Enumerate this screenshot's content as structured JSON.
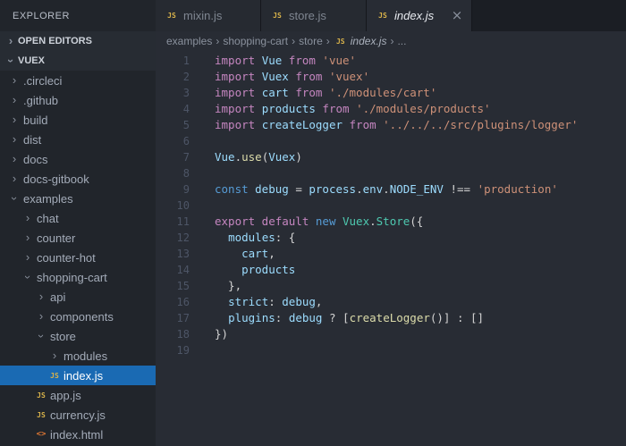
{
  "colors": {
    "editor-bg": "#282c34",
    "sidebar-bg": "#21252b",
    "section-bg": "#272c33",
    "section-fg": "#cdd2da",
    "title-fg": "#b8bec8",
    "tabbar-bg": "#1b1e24",
    "tab-inactive-bg": "#262a31",
    "tab-inactive-fg": "#7f8691",
    "tab-active-fg": "#e8ebf0",
    "tab-border": "#15171c",
    "tree-fg": "#a3abb8",
    "selection-bg": "#1a6ab3",
    "selection-fg": "#ffffff",
    "breadcrumb-fg": "#8a919d",
    "bc-active-fg": "#aab1bc",
    "line-number": "#4d5566",
    "chevron": "#8a919d",
    "js-yellow": "#d8b24a",
    "html-orange": "#e37933",
    "tk-kw": "#c586c0",
    "tk-kw2": "#569cd6",
    "tk-v": "#9cdcfe",
    "tk-s": "#ce9178",
    "tk-fn": "#dcdcaa",
    "tk-cl": "#4ec9b0",
    "tk-p": "#d4d4d4"
  },
  "icons": {
    "js": "JS",
    "html": "<>",
    "chevron": "›"
  },
  "explorer": {
    "title": "EXPLORER",
    "sections": [
      {
        "label": "OPEN EDITORS",
        "expanded": false
      },
      {
        "label": "VUEX",
        "expanded": true
      }
    ],
    "tree": [
      {
        "label": ".circleci",
        "type": "folder",
        "level": 0,
        "expanded": false
      },
      {
        "label": ".github",
        "type": "folder",
        "level": 0,
        "expanded": false
      },
      {
        "label": "build",
        "type": "folder",
        "level": 0,
        "expanded": false
      },
      {
        "label": "dist",
        "type": "folder",
        "level": 0,
        "expanded": false
      },
      {
        "label": "docs",
        "type": "folder",
        "level": 0,
        "expanded": false
      },
      {
        "label": "docs-gitbook",
        "type": "folder",
        "level": 0,
        "expanded": false
      },
      {
        "label": "examples",
        "type": "folder",
        "level": 0,
        "expanded": true
      },
      {
        "label": "chat",
        "type": "folder",
        "level": 1,
        "expanded": false
      },
      {
        "label": "counter",
        "type": "folder",
        "level": 1,
        "expanded": false
      },
      {
        "label": "counter-hot",
        "type": "folder",
        "level": 1,
        "expanded": false
      },
      {
        "label": "shopping-cart",
        "type": "folder",
        "level": 1,
        "expanded": true
      },
      {
        "label": "api",
        "type": "folder",
        "level": 2,
        "expanded": false
      },
      {
        "label": "components",
        "type": "folder",
        "level": 2,
        "expanded": false
      },
      {
        "label": "store",
        "type": "folder",
        "level": 2,
        "expanded": true
      },
      {
        "label": "modules",
        "type": "folder",
        "level": 3,
        "expanded": false
      },
      {
        "label": "index.js",
        "type": "file",
        "icon": "js",
        "level": 3,
        "selected": true
      },
      {
        "label": "app.js",
        "type": "file",
        "icon": "js",
        "level": 2
      },
      {
        "label": "currency.js",
        "type": "file",
        "icon": "js",
        "level": 2
      },
      {
        "label": "index.html",
        "type": "file",
        "icon": "html",
        "level": 2
      }
    ]
  },
  "tabs": [
    {
      "label": "mixin.js",
      "icon": "js",
      "active": false
    },
    {
      "label": "store.js",
      "icon": "js",
      "active": false
    },
    {
      "label": "index.js",
      "icon": "js",
      "active": true,
      "close": "×"
    }
  ],
  "breadcrumb": {
    "separator": "›",
    "items": [
      {
        "label": "examples"
      },
      {
        "label": "shopping-cart"
      },
      {
        "label": "store"
      },
      {
        "label": "index.js",
        "icon": "js",
        "italic": true
      },
      {
        "label": "..."
      }
    ]
  },
  "editor": {
    "lines": [
      {
        "n": "1",
        "t": [
          [
            "kw",
            "import "
          ],
          [
            "v",
            "Vue"
          ],
          [
            "kw",
            " from "
          ],
          [
            "s",
            "'vue'"
          ]
        ]
      },
      {
        "n": "2",
        "t": [
          [
            "kw",
            "import "
          ],
          [
            "v",
            "Vuex"
          ],
          [
            "kw",
            " from "
          ],
          [
            "s",
            "'vuex'"
          ]
        ]
      },
      {
        "n": "3",
        "t": [
          [
            "kw",
            "import "
          ],
          [
            "v",
            "cart"
          ],
          [
            "kw",
            " from "
          ],
          [
            "s",
            "'./modules/cart'"
          ]
        ]
      },
      {
        "n": "4",
        "t": [
          [
            "kw",
            "import "
          ],
          [
            "v",
            "products"
          ],
          [
            "kw",
            " from "
          ],
          [
            "s",
            "'./modules/products'"
          ]
        ]
      },
      {
        "n": "5",
        "t": [
          [
            "kw",
            "import "
          ],
          [
            "v",
            "createLogger"
          ],
          [
            "kw",
            " from "
          ],
          [
            "s",
            "'../../../src/plugins/logger'"
          ]
        ]
      },
      {
        "n": "6",
        "t": []
      },
      {
        "n": "7",
        "t": [
          [
            "v",
            "Vue"
          ],
          [
            "p",
            "."
          ],
          [
            "fn",
            "use"
          ],
          [
            "p",
            "("
          ],
          [
            "v",
            "Vuex"
          ],
          [
            "p",
            ")"
          ]
        ]
      },
      {
        "n": "8",
        "t": []
      },
      {
        "n": "9",
        "t": [
          [
            "kw2",
            "const "
          ],
          [
            "v",
            "debug"
          ],
          [
            "p",
            " = "
          ],
          [
            "v",
            "process"
          ],
          [
            "p",
            "."
          ],
          [
            "v",
            "env"
          ],
          [
            "p",
            "."
          ],
          [
            "v",
            "NODE_ENV"
          ],
          [
            "p",
            " !== "
          ],
          [
            "s",
            "'production'"
          ]
        ]
      },
      {
        "n": "10",
        "t": []
      },
      {
        "n": "11",
        "t": [
          [
            "kw",
            "export default "
          ],
          [
            "kw2",
            "new "
          ],
          [
            "cl",
            "Vuex"
          ],
          [
            "p",
            "."
          ],
          [
            "cl",
            "Store"
          ],
          [
            "p",
            "({"
          ]
        ]
      },
      {
        "n": "12",
        "t": [
          [
            "p",
            "  "
          ],
          [
            "v",
            "modules"
          ],
          [
            "p",
            ": {"
          ]
        ]
      },
      {
        "n": "13",
        "t": [
          [
            "p",
            "    "
          ],
          [
            "v",
            "cart"
          ],
          [
            "p",
            ","
          ]
        ]
      },
      {
        "n": "14",
        "t": [
          [
            "p",
            "    "
          ],
          [
            "v",
            "products"
          ]
        ]
      },
      {
        "n": "15",
        "t": [
          [
            "p",
            "  },"
          ]
        ]
      },
      {
        "n": "16",
        "t": [
          [
            "p",
            "  "
          ],
          [
            "v",
            "strict"
          ],
          [
            "p",
            ": "
          ],
          [
            "v",
            "debug"
          ],
          [
            "p",
            ","
          ]
        ]
      },
      {
        "n": "17",
        "t": [
          [
            "p",
            "  "
          ],
          [
            "v",
            "plugins"
          ],
          [
            "p",
            ": "
          ],
          [
            "v",
            "debug"
          ],
          [
            "p",
            " ? ["
          ],
          [
            "fn",
            "createLogger"
          ],
          [
            "p",
            "()] : []"
          ]
        ]
      },
      {
        "n": "18",
        "t": [
          [
            "p",
            "})"
          ]
        ]
      },
      {
        "n": "19",
        "t": []
      }
    ]
  }
}
